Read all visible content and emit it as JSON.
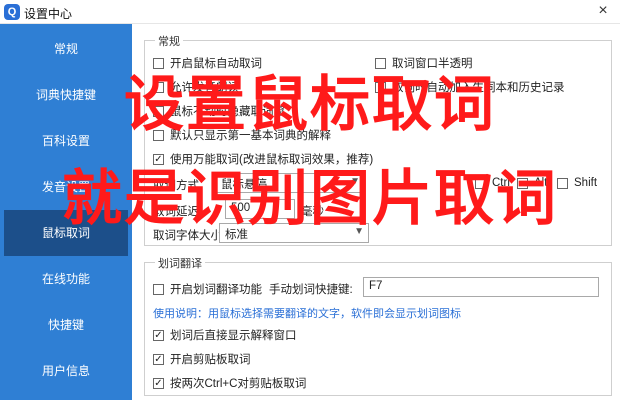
{
  "window": {
    "title": "设置中心",
    "logo_glyph": "Q",
    "close_glyph": "×"
  },
  "sidebar": {
    "items": [
      {
        "label": "常规"
      },
      {
        "label": "词典快捷键"
      },
      {
        "label": "百科设置"
      },
      {
        "label": "发音设置"
      },
      {
        "label": "鼠标取词"
      },
      {
        "label": "在线功能"
      },
      {
        "label": "快捷键"
      },
      {
        "label": "用户信息"
      }
    ],
    "active_index": 4
  },
  "general": {
    "legend": "常规",
    "enable_mouse_lookup": {
      "label": "开启鼠标自动取词",
      "checked": false
    },
    "semi_transparent": {
      "label": "取词窗口半透明",
      "checked": false
    },
    "allow_speak": {
      "label": "允许发音朗读",
      "checked": false
    },
    "auto_add_history": {
      "label": "取词时自动加入生词本和历史记录",
      "checked": false
    },
    "hide_preview": {
      "label": "鼠标不动时隐藏取词窗",
      "checked": false
    },
    "show_first_explain": {
      "label": "默认只显示第一基本词典的解释",
      "checked": false
    },
    "universal_lookup": {
      "label": "使用万能取词(改进鼠标取词效果，推荐)",
      "checked": true
    },
    "lookup_method_label": "取词方式",
    "lookup_method_value": "鼠标悬停",
    "modifier_ctrl": "Ctrl",
    "modifier_alt": "Alt",
    "modifier_shift": "Shift",
    "delay_label": "取词延迟",
    "delay_value": "500",
    "delay_unit": "毫秒",
    "font_size_label": "取词字体大小",
    "font_size_value": "标准"
  },
  "selection_translate": {
    "legend": "划词翻译",
    "enable": {
      "label": "开启划词翻译功能",
      "checked": false
    },
    "hotkey_label": "手动划词快捷键:",
    "hotkey_value": "F7",
    "usage_note": "使用说明：用鼠标选择需要翻译的文字，软件即会显示划词图标",
    "show_explain": {
      "label": "划词后直接显示解释窗口",
      "checked": true
    },
    "clipboard_lookup": {
      "label": "开启剪贴板取词",
      "checked": true
    },
    "double_ctrl_c": {
      "label": "按两次Ctrl+C对剪贴板取词",
      "checked": true
    }
  },
  "overlay": {
    "line1": "设置鼠标取词",
    "line2": "就是识别图片取词",
    "color": "#ff1a1a"
  },
  "colors": {
    "sidebar_bg": "#2f7fd4",
    "sidebar_active": "#1c4f8a",
    "accent": "#2a6fd6"
  }
}
